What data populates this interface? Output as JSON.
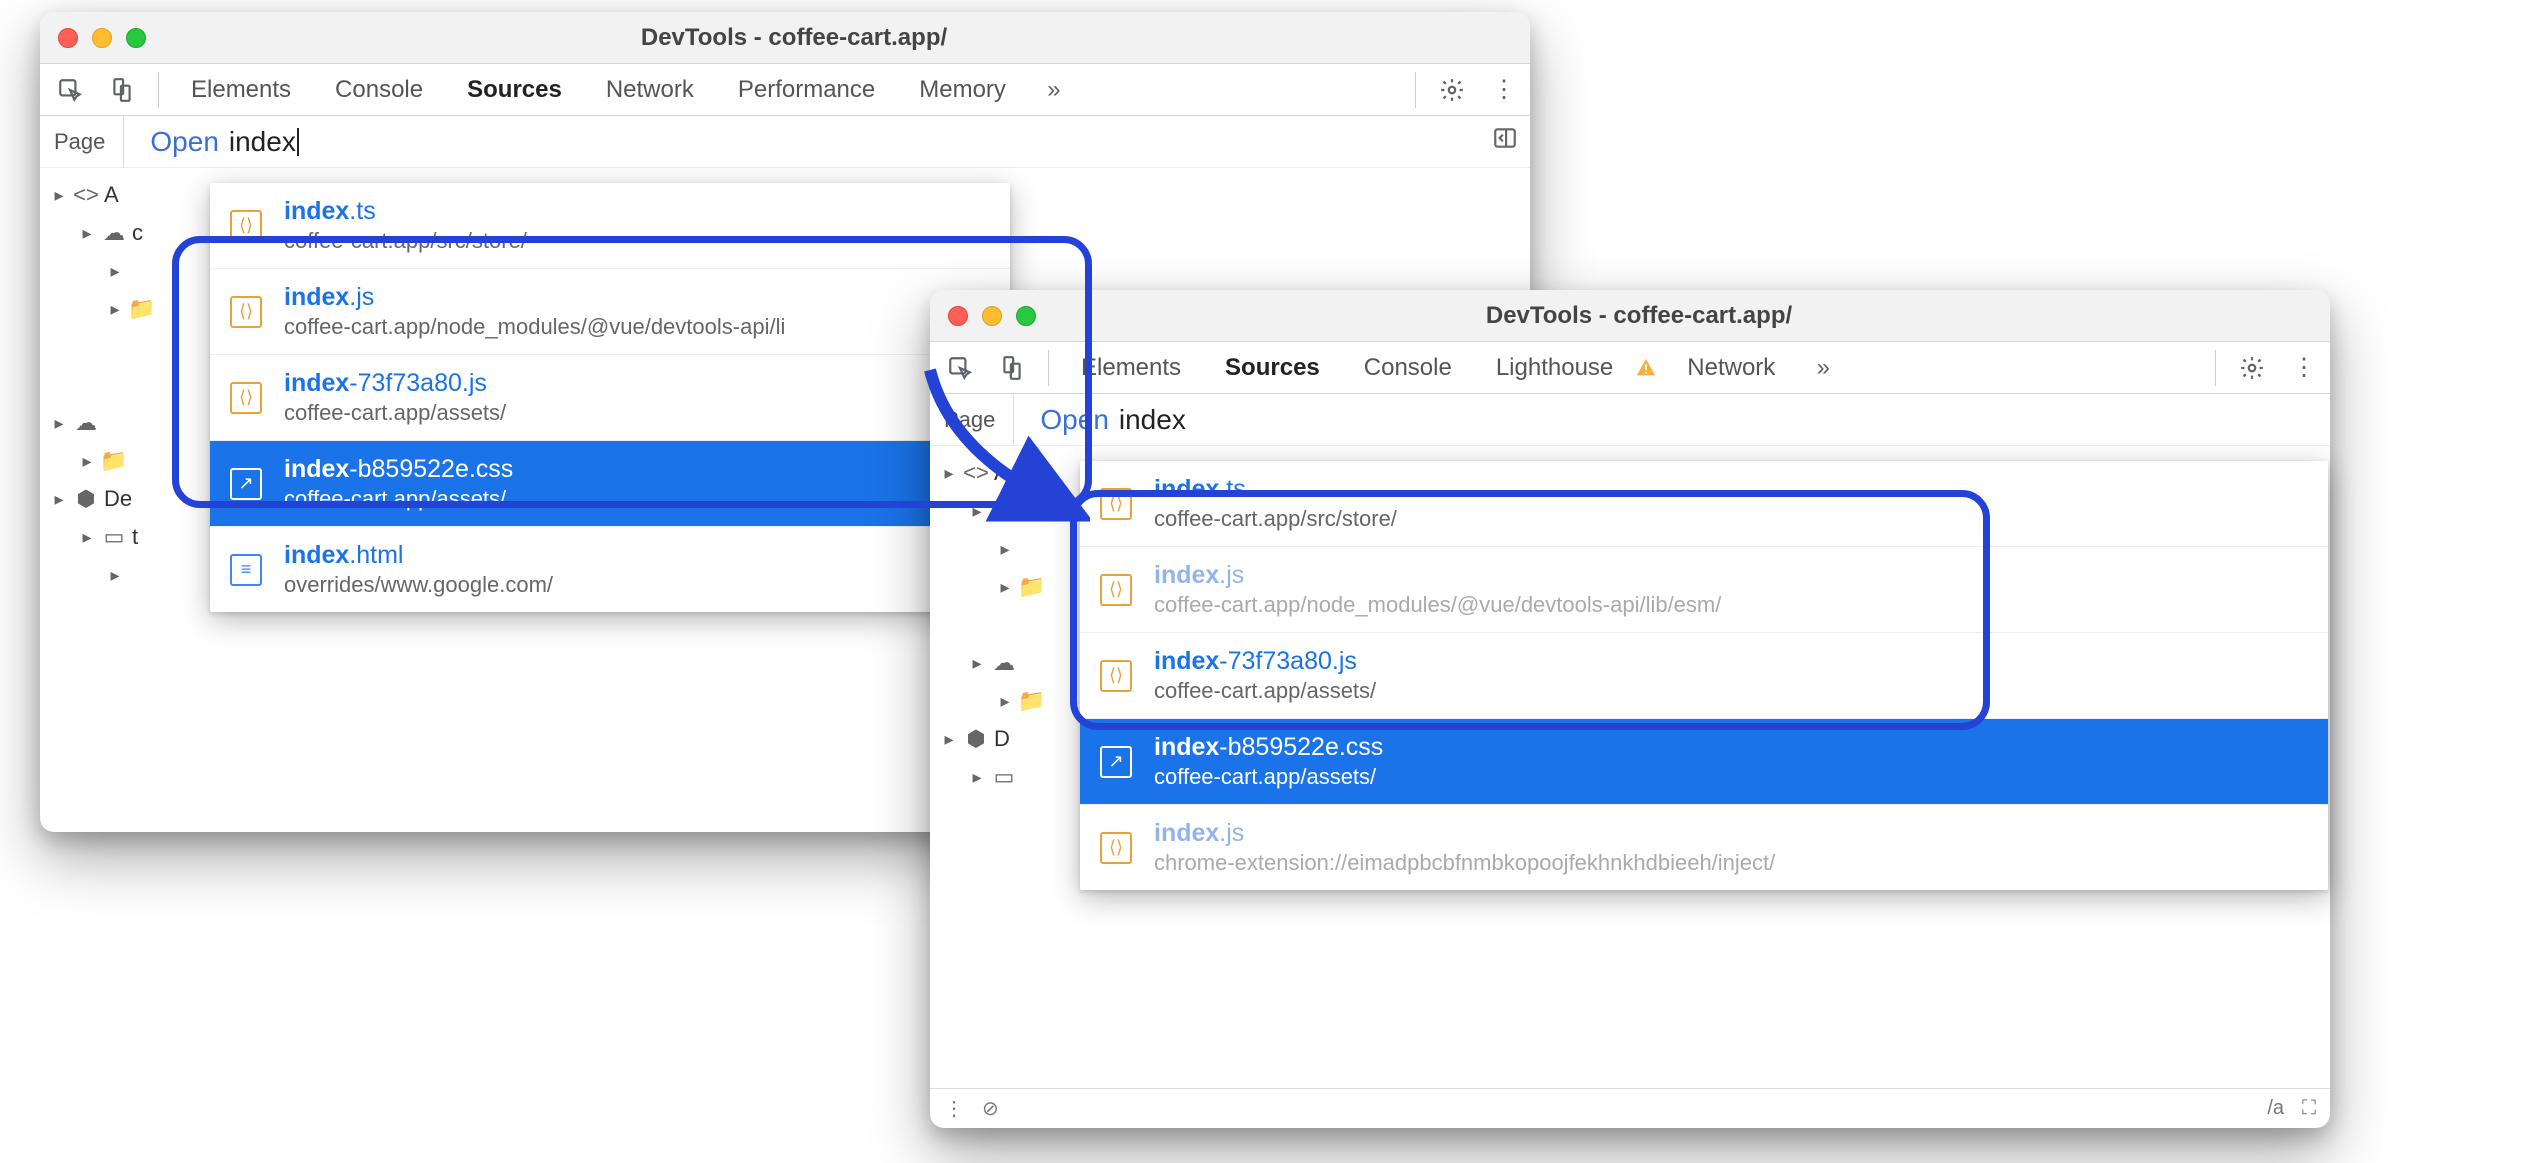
{
  "win1": {
    "title": "DevTools - coffee-cart.app/",
    "tabs": [
      "Elements",
      "Console",
      "Sources",
      "Network",
      "Performance",
      "Memory"
    ],
    "active_tab": "Sources",
    "page_tab": "Page",
    "open_label": "Open",
    "open_query": "index",
    "tree": [
      {
        "level": 0,
        "chev": "▶",
        "glyph": "<>",
        "label": "A"
      },
      {
        "level": 1,
        "chev": "▶",
        "glyph": "☁",
        "label": "c"
      },
      {
        "level": 2,
        "chev": "▶",
        "glyph": "",
        "label": ""
      },
      {
        "level": 2,
        "chev": "▶",
        "glyph": "📁",
        "label": ""
      },
      {
        "level": 1,
        "chev": "",
        "glyph": "",
        "label": ""
      },
      {
        "level": 1,
        "chev": "",
        "glyph": "",
        "label": ""
      },
      {
        "level": 0,
        "chev": "▶",
        "glyph": "☁",
        "label": ""
      },
      {
        "level": 1,
        "chev": "▶",
        "glyph": "📁",
        "label": ""
      },
      {
        "level": 0,
        "chev": "▶",
        "glyph": "◈",
        "label": "De"
      },
      {
        "level": 1,
        "chev": "▶",
        "glyph": "▭",
        "label": "t"
      },
      {
        "level": 2,
        "chev": "▶",
        "glyph": "",
        "label": ""
      }
    ],
    "items": [
      {
        "icon": "js",
        "match": "index",
        "rest": ".ts",
        "path": "coffee-cart.app/src/store/"
      },
      {
        "icon": "js",
        "match": "index",
        "rest": ".js",
        "path": "coffee-cart.app/node_modules/@vue/devtools-api/li"
      },
      {
        "icon": "js",
        "match": "index",
        "rest": "-73f73a80.js",
        "path": "coffee-cart.app/assets/"
      },
      {
        "icon": "css",
        "match": "index",
        "rest": "-b859522e.css",
        "path": "coffee-cart.app/assets/",
        "selected": true
      },
      {
        "icon": "html",
        "match": "index",
        "rest": ".html",
        "path": "overrides/www.google.com/"
      }
    ]
  },
  "win2": {
    "title": "DevTools - coffee-cart.app/",
    "tabs": [
      "Elements",
      "Sources",
      "Console",
      "Lighthouse",
      "Network"
    ],
    "active_tab": "Sources",
    "show_warn": true,
    "page_tab": "Page",
    "open_label": "Open",
    "open_query": "index",
    "tree": [
      {
        "level": 0,
        "chev": "▶",
        "glyph": "<>",
        "label": "A"
      },
      {
        "level": 1,
        "chev": "▶",
        "glyph": "☁",
        "label": ""
      },
      {
        "level": 2,
        "chev": "▶",
        "glyph": "",
        "label": ""
      },
      {
        "level": 2,
        "chev": "▶",
        "glyph": "📁",
        "label": ""
      },
      {
        "level": 2,
        "chev": "",
        "glyph": "",
        "label": ""
      },
      {
        "level": 1,
        "chev": "▶",
        "glyph": "☁",
        "label": ""
      },
      {
        "level": 2,
        "chev": "▶",
        "glyph": "📁",
        "label": ""
      },
      {
        "level": 0,
        "chev": "▶",
        "glyph": "◈",
        "label": "D"
      },
      {
        "level": 1,
        "chev": "▶",
        "glyph": "▭",
        "label": ""
      }
    ],
    "items": [
      {
        "icon": "js",
        "match": "index",
        "rest": ".ts",
        "path": "coffee-cart.app/src/store/"
      },
      {
        "icon": "js",
        "match": "index",
        "rest": ".js",
        "path": "coffee-cart.app/node_modules/@vue/devtools-api/lib/esm/",
        "faded": true
      },
      {
        "icon": "js",
        "match": "index",
        "rest": "-73f73a80.js",
        "path": "coffee-cart.app/assets/"
      },
      {
        "icon": "css",
        "match": "index",
        "rest": "-b859522e.css",
        "path": "coffee-cart.app/assets/",
        "selected": true
      },
      {
        "icon": "js",
        "match": "index",
        "rest": ".js",
        "path": "chrome-extension://eimadpbcbfnmbkopoojfekhnkhdbieeh/inject/",
        "faded": true
      }
    ],
    "bottom_text": "/a"
  }
}
